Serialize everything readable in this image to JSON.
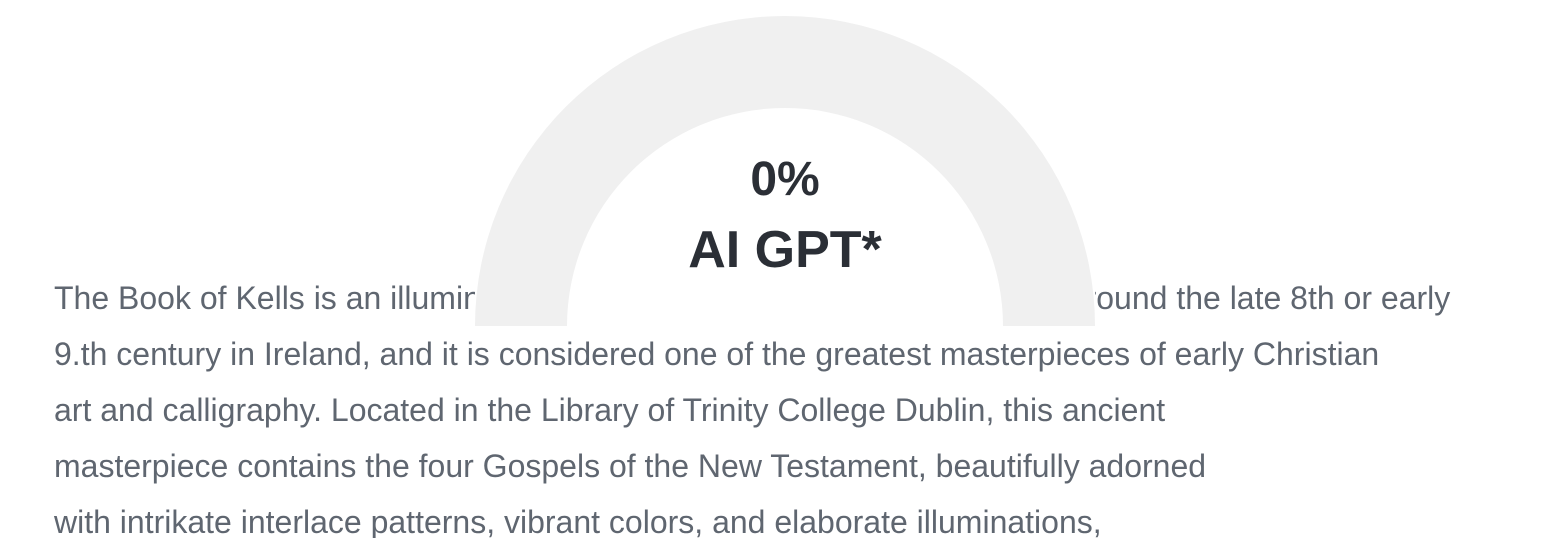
{
  "gauge": {
    "value_percent": 0,
    "percent_label": "0%",
    "label": "AI GPT*",
    "track_color": "#f0f0f0",
    "text_color": "#2b2f36"
  },
  "article": {
    "text_color": "#5f6670",
    "lines": [
      "The Book of Kells is an illuminated manuscript created by Celtic monks around the late 8th or early",
      "9.th century in Ireland, and it is considered one of the greatest masterpieces of early Christian",
      "art and calligraphy. Located in the Library of Trinity College Dublin, this ancient",
      "masterpiece contains the four Gospels of the New Testament, beautifully adorned",
      "with intrikate interlace patterns, vibrant colors, and elaborate illuminations,"
    ]
  }
}
